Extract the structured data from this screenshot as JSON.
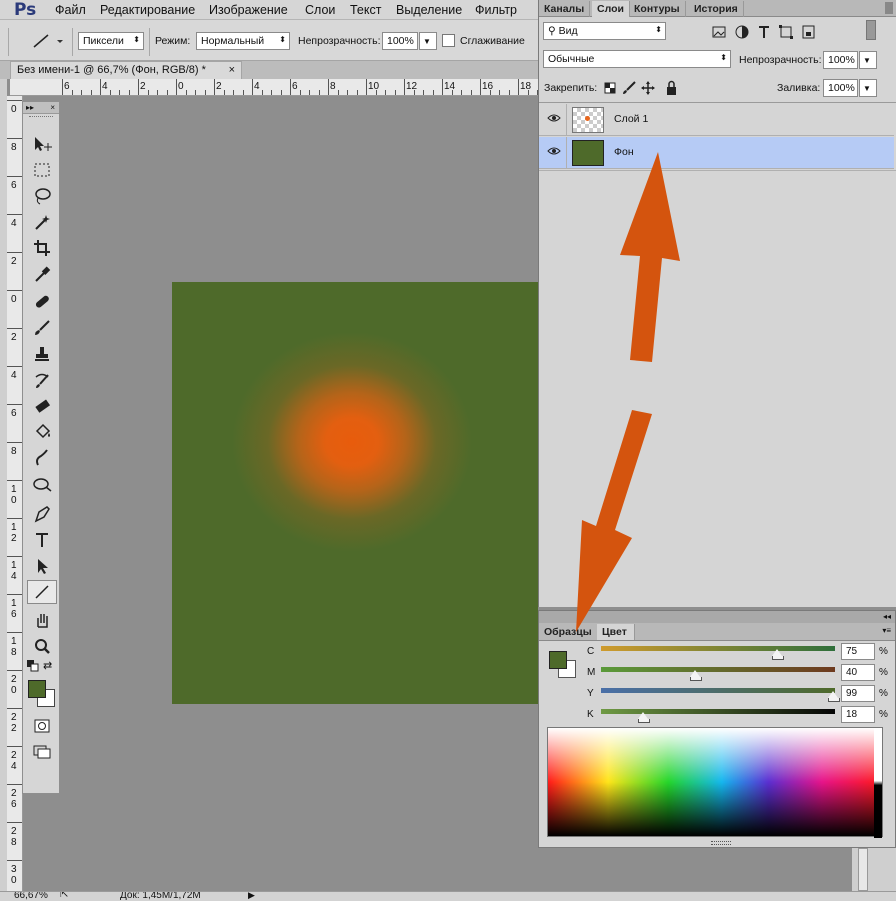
{
  "menubar": {
    "logo": "Ps",
    "items": [
      "Файл",
      "Редактирование",
      "Изображение",
      "Слои",
      "Текст",
      "Выделение",
      "Фильтр"
    ]
  },
  "options": {
    "units": "Пиксели",
    "mode_label": "Режим:",
    "mode_value": "Нормальный",
    "opacity_label": "Непрозрачность:",
    "opacity_value": "100%",
    "antialias_label": "Сглаживание"
  },
  "document": {
    "tab_title": "Без имени-1 @ 66,7% (Фон, RGB/8) *",
    "close_glyph": "×"
  },
  "rulers": {
    "horizontal": [
      "6",
      "4",
      "2",
      "0",
      "2",
      "4",
      "6",
      "8",
      "10",
      "12",
      "14",
      "16",
      "18",
      "20"
    ],
    "vertical": [
      "0",
      "8",
      "6",
      "4",
      "2",
      "0",
      "2",
      "4",
      "6",
      "8",
      "10",
      "12",
      "14",
      "16",
      "18",
      "20",
      "22",
      "24",
      "26",
      "28",
      "30"
    ]
  },
  "status": {
    "zoom": "66,67%",
    "doc": "Док: 1,45M/1,72M"
  },
  "layers_panel": {
    "tabs": [
      "Каналы",
      "Слои",
      "Контуры",
      "История"
    ],
    "active_tab": "Слои",
    "filter_value": "Вид",
    "blend_mode": "Обычные",
    "opacity_label": "Непрозрачность:",
    "opacity_value": "100%",
    "lock_label": "Закрепить:",
    "fill_label": "Заливка:",
    "fill_value": "100%",
    "layers": [
      {
        "name": "Слой 1",
        "selected": false
      },
      {
        "name": "Фон",
        "selected": true
      }
    ]
  },
  "color_panel": {
    "tabs": [
      "Образцы",
      "Цвет"
    ],
    "active_tab": "Цвет",
    "sliders": [
      {
        "label": "C",
        "value": "75",
        "unit": "%"
      },
      {
        "label": "M",
        "value": "40",
        "unit": "%"
      },
      {
        "label": "Y",
        "value": "99",
        "unit": "%"
      },
      {
        "label": "K",
        "value": "18",
        "unit": "%"
      }
    ]
  },
  "colors": {
    "foreground": "#4e6a2a",
    "background": "#ffffff",
    "glow": "#e85c0c",
    "arrow": "#d4540e",
    "selected_layer": "#b6cbf5"
  }
}
